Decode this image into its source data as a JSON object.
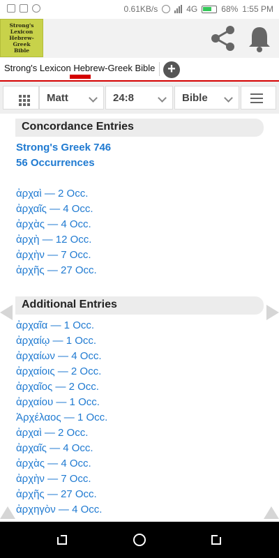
{
  "status": {
    "speed": "0.61KB/s",
    "network": "4G",
    "battery": "68%",
    "time": "1:55 PM"
  },
  "app": {
    "logo_lines": [
      "Strong's",
      "Lexicon",
      "Hebrew-Greek",
      "Bible"
    ],
    "share_icon": "share-icon",
    "bell_icon": "bell-icon"
  },
  "tabs": {
    "active_label": "Strong's Lexicon Hebrew-Greek Bible",
    "add_label": "+"
  },
  "nav": {
    "book": "Matt",
    "reference": "24:8",
    "version": "Bible"
  },
  "concordance": {
    "heading": "Concordance Entries",
    "strongs": "Strong's Greek 746",
    "occurrences": "56 Occurrences",
    "entries": [
      "ἀρχαὶ — 2 Occ.",
      "ἀρχαῖς — 4 Occ.",
      "ἀρχὰς — 4 Occ.",
      "ἀρχὴ — 12 Occ.",
      "ἀρχὴν — 7 Occ.",
      "ἀρχῆς — 27 Occ."
    ]
  },
  "additional": {
    "heading": "Additional Entries",
    "entries": [
      "ἀρχαῖα — 1 Occ.",
      "ἀρχαίῳ — 1 Occ.",
      "ἀρχαίων — 4 Occ.",
      "ἀρχαίοις — 2 Occ.",
      "ἀρχαῖος — 2 Occ.",
      "ἀρχαίου — 1 Occ.",
      "Ἀρχέλαος — 1 Occ.",
      "ἀρχαὶ — 2 Occ.",
      "ἀρχαῖς — 4 Occ.",
      "ἀρχὰς — 4 Occ.",
      "ἀρχὴν — 7 Occ.",
      "ἀρχῆς — 27 Occ.",
      "ἀρχηγὸν — 4 Occ."
    ]
  }
}
